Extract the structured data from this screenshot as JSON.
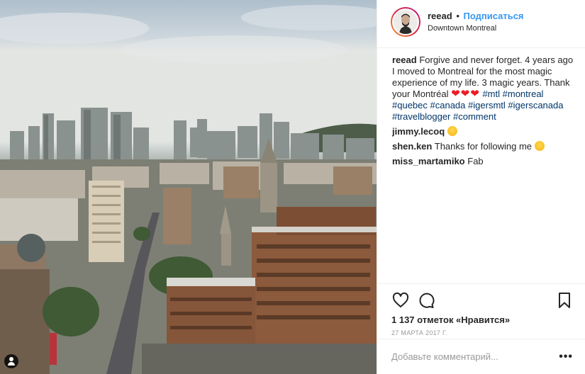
{
  "header": {
    "username": "reead",
    "separator": "•",
    "follow_label": "Подписаться",
    "location": "Downtown Montreal"
  },
  "caption": {
    "username": "reead",
    "text": "Forgive and never forget. 4 years ago I moved to Montreal for the most magic experience of my life. 3 magic years. Thank your Montréal",
    "hearts": "❤❤❤",
    "hashtags": [
      "#mtl",
      "#montreal",
      "#quebec",
      "#canada",
      "#igersmtl",
      "#igerscanada",
      "#travelblogger",
      "#comment"
    ]
  },
  "comments": [
    {
      "username": "jimmy.lecoq",
      "text": "",
      "emoji": "heart-eyes-emoji"
    },
    {
      "username": "shen.ken",
      "text": "Thanks for following me",
      "emoji": "wink-emoji"
    },
    {
      "username": "miss_martamiko",
      "text": "Fab",
      "emoji": ""
    }
  ],
  "actions": {
    "like_icon": "heart-outline-icon",
    "comment_icon": "speech-bubble-icon",
    "save_icon": "bookmark-icon"
  },
  "likes_text": "1 137 отметок «Нравится»",
  "date_text": "27 марта 2017 г.",
  "add_comment": {
    "placeholder": "Добавьте комментарий...",
    "more_label": "•••"
  },
  "photo": {
    "description_icon": "user-tag-icon"
  },
  "colors": {
    "link_blue": "#3897f0",
    "hashtag": "#003569",
    "text": "#262626",
    "muted": "#999999"
  }
}
